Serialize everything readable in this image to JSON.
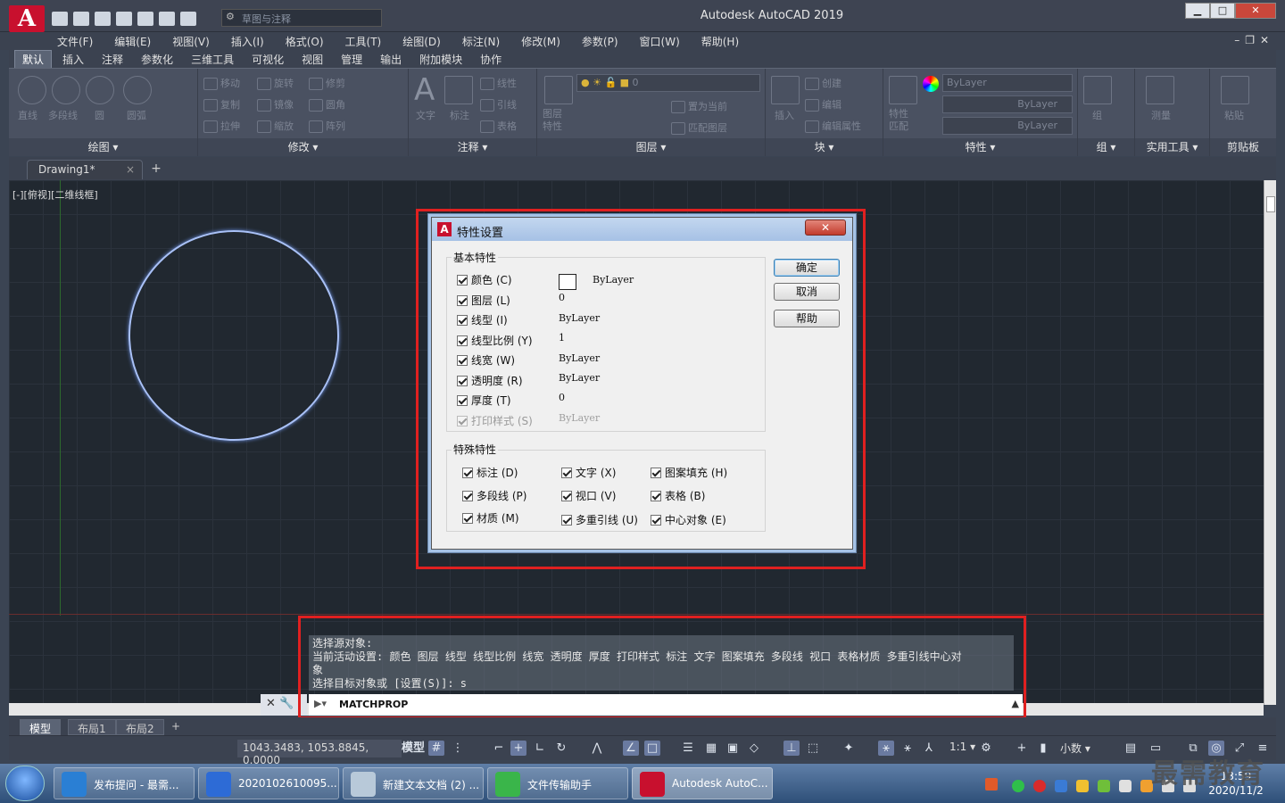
{
  "app": {
    "logo": "A",
    "title": "Autodesk AutoCAD 2019",
    "workspace_placeholder": "草图与注释",
    "win_min": "▁",
    "win_max": "□",
    "win_close": "✕",
    "doc_controls": "–❐✕"
  },
  "menu": [
    "文件(F)",
    "编辑(E)",
    "视图(V)",
    "插入(I)",
    "格式(O)",
    "工具(T)",
    "绘图(D)",
    "标注(N)",
    "修改(M)",
    "参数(P)",
    "窗口(W)",
    "帮助(H)"
  ],
  "ribbon_tabs": [
    "默认",
    "插入",
    "注释",
    "参数化",
    "三维工具",
    "可视化",
    "视图",
    "管理",
    "输出",
    "附加模块",
    "协作"
  ],
  "ribbon": {
    "draw": {
      "title": "绘图 ▾",
      "buttons": [
        "直线",
        "多段线",
        "圆",
        "圆弧"
      ]
    },
    "modify": {
      "title": "修改 ▾",
      "buttons": [
        "移动",
        "旋转",
        "修剪",
        "复制",
        "镜像",
        "圆角",
        "拉伸",
        "缩放",
        "阵列"
      ]
    },
    "annotate": {
      "title": "注释 ▾",
      "buttons": [
        "文字",
        "标注",
        "线性",
        "引线",
        "表格"
      ]
    },
    "layers": {
      "title": "图层 ▾",
      "layer_value": "0",
      "buttons": [
        "图层特性",
        "置为当前",
        "匹配图层"
      ]
    },
    "block": {
      "title": "块 ▾",
      "buttons": [
        "插入",
        "创建",
        "编辑",
        "编辑属性"
      ]
    },
    "properties": {
      "title": "特性 ▾",
      "match": "特性匹配",
      "color": "ByLayer",
      "linetype": "ByLayer",
      "lineweight": "ByLayer"
    },
    "groups": {
      "title": "组 ▾",
      "button": "组"
    },
    "utilities": {
      "title": "实用工具 ▾",
      "button": "测量"
    },
    "clipboard": {
      "title": "剪贴板",
      "button": "粘贴"
    }
  },
  "file_tab": {
    "name": "Drawing1*",
    "close": "×",
    "add": "+"
  },
  "viewport_label": "[-][俯视][二维线框]",
  "dialog": {
    "title": "特性设置",
    "close": "✕",
    "basic_title": "基本特性",
    "basic": [
      {
        "label": "颜色 (C)",
        "value": "ByLayer",
        "enabled": true
      },
      {
        "label": "图层 (L)",
        "value": "0",
        "enabled": true
      },
      {
        "label": "线型 (I)",
        "value": "ByLayer",
        "enabled": true
      },
      {
        "label": "线型比例 (Y)",
        "value": "1",
        "enabled": true
      },
      {
        "label": "线宽 (W)",
        "value": "ByLayer",
        "enabled": true
      },
      {
        "label": "透明度 (R)",
        "value": "ByLayer",
        "enabled": true
      },
      {
        "label": "厚度 (T)",
        "value": "0",
        "enabled": true
      },
      {
        "label": "打印样式 (S)",
        "value": "ByLayer",
        "enabled": false
      }
    ],
    "special_title": "特殊特性",
    "special": [
      "标注 (D)",
      "文字 (X)",
      "图案填充 (H)",
      "多段线 (P)",
      "视口 (V)",
      "表格 (B)",
      "材质 (M)",
      "多重引线 (U)",
      "中心对象 (E)"
    ],
    "ok": "确定",
    "cancel": "取消",
    "help": "帮助"
  },
  "command": {
    "lines": [
      "选择源对象:",
      "当前活动设置:  颜色 图层 线型 线型比例 线宽 透明度 厚度 打印样式 标注 文字 图案填充 多段线 视口 表格材质 多重引线中心对",
      "象",
      "选择目标对象或 [设置(S)]: s"
    ],
    "input": "MATCHPROP",
    "handle": "✕ 🔧"
  },
  "layout_tabs": [
    "模型",
    "布局1",
    "布局2",
    "+"
  ],
  "status": {
    "coords": "1043.3483, 1053.8845, 0.0000",
    "model": "模型",
    "scale": "1:1 ▾",
    "units": "小数 ▾"
  },
  "taskbar": {
    "items": [
      "发布提问 - 最需...",
      "2020102610095...",
      "新建文本文档 (2) ...",
      "文件传输助手",
      "Autodesk AutoC..."
    ],
    "time": "13:59",
    "date": "2020/11/2"
  },
  "watermark": "最需教育",
  "colors": {
    "highlight": "#e02020",
    "canvas": "#212830",
    "circle": "#a9c1f7"
  }
}
